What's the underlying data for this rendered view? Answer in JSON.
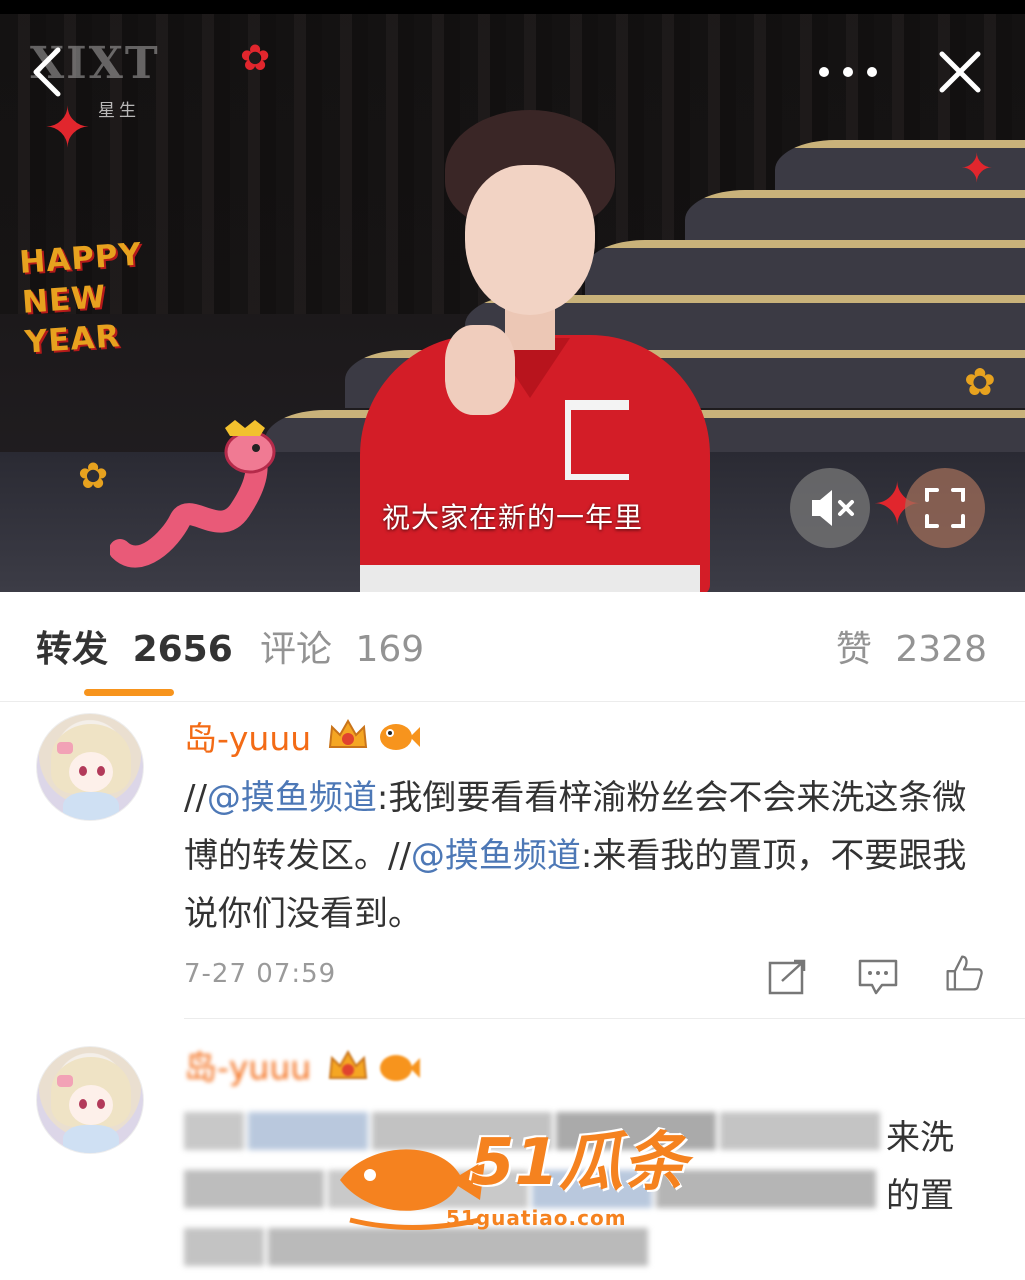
{
  "video": {
    "watermark_logo": "XIXT",
    "watermark_sub": "星生",
    "subtitle": "祝大家在新的一年里",
    "happy_new_year": [
      "HAPPY",
      "NEW",
      "YEAR"
    ],
    "icons": {
      "back": "chevron-left-icon",
      "more": "more-dots-icon",
      "close": "close-icon",
      "mute": "mute-icon",
      "fullscreen": "fullscreen-icon"
    }
  },
  "tabs": {
    "repost": {
      "label": "转发",
      "count": "2656"
    },
    "comment": {
      "label": "评论",
      "count": "169"
    },
    "like": {
      "label": "赞",
      "count": "2328"
    }
  },
  "reposts": [
    {
      "username": "岛-yuuu",
      "segments": [
        {
          "text": "//",
          "mention": false
        },
        {
          "text": "@摸鱼频道",
          "mention": true
        },
        {
          "text": ":我倒要看看梓渝粉丝会不会来洗这条微博的转发区。//",
          "mention": false
        },
        {
          "text": "@摸鱼频道",
          "mention": true
        },
        {
          "text": ":来看我的置顶，不要跟我说你们没看到。",
          "mention": false
        }
      ],
      "time": "7-27 07:59",
      "actions": [
        "share-icon",
        "comment-icon",
        "like-icon"
      ]
    },
    {
      "username": "岛-yuuu",
      "visible_tail_1": "来洗",
      "visible_tail_2": "的置"
    }
  ],
  "watermark": {
    "brand": "51瓜条",
    "url": "51guatiao.com"
  },
  "colors": {
    "accent_orange": "#f7941d",
    "username_orange": "#f36b16",
    "mention_blue": "#4d78b6",
    "jacket_red": "#d31d27"
  }
}
